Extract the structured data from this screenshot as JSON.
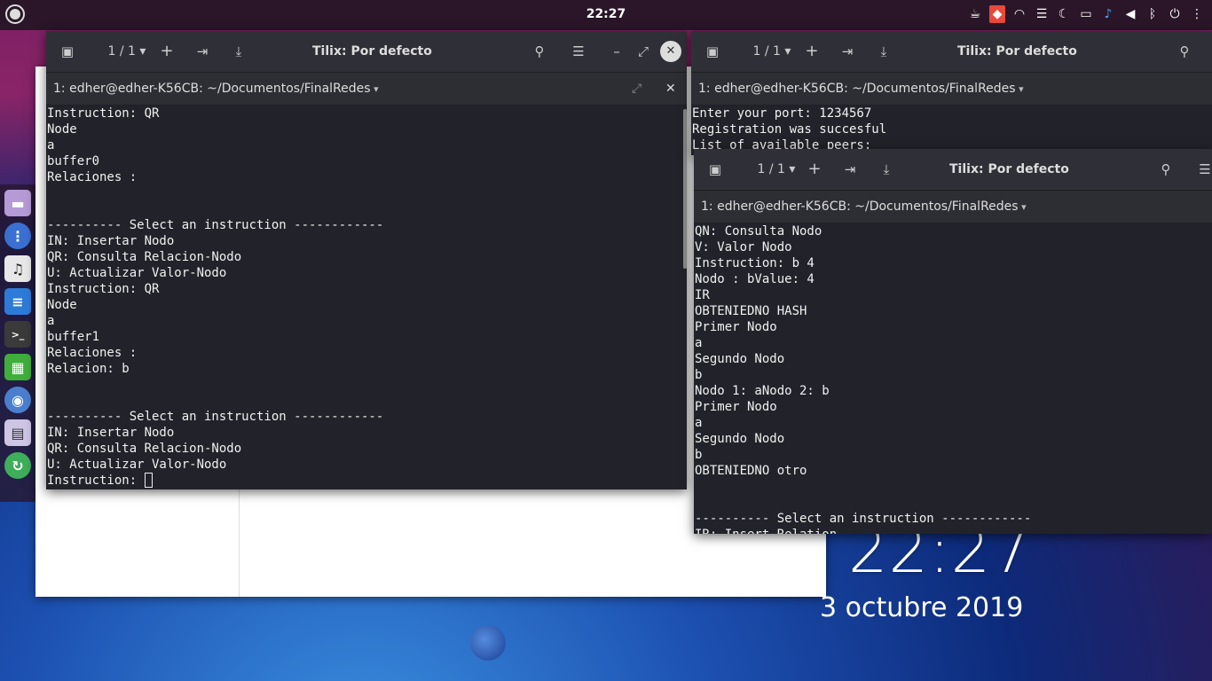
{
  "panel": {
    "clock": "22:27"
  },
  "dock": {
    "apps": [
      {
        "name": "files"
      },
      {
        "name": "app-grid"
      },
      {
        "name": "music"
      },
      {
        "name": "text-editor"
      },
      {
        "name": "terminal"
      },
      {
        "name": "spreadsheet"
      },
      {
        "name": "chrome"
      },
      {
        "name": "document"
      },
      {
        "name": "updater"
      }
    ]
  },
  "desktop": {
    "time": "22:27",
    "date": "3 octubre 2019"
  },
  "window1": {
    "session_counter": "1 / 1",
    "title": "Tilix: Por defecto",
    "terminal_title": "1: edher@edher-K56CB: ~/Documentos/FinalRedes",
    "lines": [
      "Instruction: QR",
      "Node",
      "a",
      "buffer0",
      "Relaciones :",
      "",
      "",
      "---------- Select an instruction ------------",
      "IN: Insertar Nodo",
      "QR: Consulta Relacion-Nodo",
      "U: Actualizar Valor-Nodo",
      "Instruction: QR",
      "Node",
      "a",
      "buffer1",
      "Relaciones :",
      "Relacion: b",
      "",
      "",
      "---------- Select an instruction ------------",
      "IN: Insertar Nodo",
      "QR: Consulta Relacion-Nodo",
      "U: Actualizar Valor-Nodo"
    ],
    "prompt": "Instruction: "
  },
  "window2": {
    "session_counter": "1 / 1",
    "title": "Tilix: Por defecto",
    "terminal_title": "1: edher@edher-K56CB: ~/Documentos/FinalRedes",
    "lines": [
      "Enter your port: 1234567",
      "Registration was succesful",
      "List of available peers:"
    ]
  },
  "window3": {
    "session_counter": "1 / 1",
    "title": "Tilix: Por defecto",
    "terminal_title": "1: edher@edher-K56CB: ~/Documentos/FinalRedes",
    "lines": [
      "QN: Consulta Nodo",
      "V: Valor Nodo",
      "Instruction: b 4",
      "Nodo : bValue: 4",
      "IR",
      "OBTENIEDNO HASH",
      "Primer Nodo",
      "a",
      "Segundo Nodo",
      "b",
      "Nodo 1: aNodo 2: b",
      "Primer Nodo",
      "a",
      "Segundo Nodo",
      "b",
      "OBTENIEDNO otro",
      "",
      "",
      "---------- Select an instruction ------------",
      "IR: Insert Relation"
    ]
  }
}
